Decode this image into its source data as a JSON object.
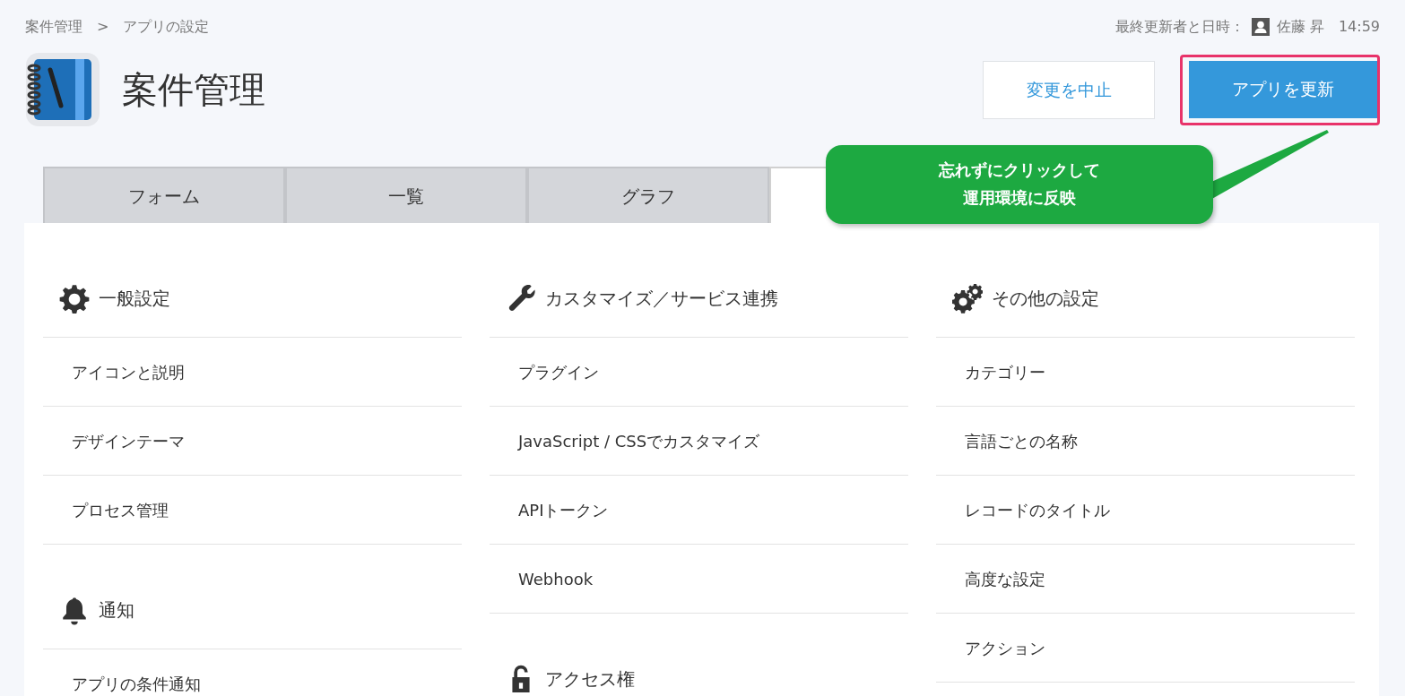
{
  "breadcrumb": {
    "items": [
      {
        "label": "案件管理"
      },
      {
        "label": "アプリの設定"
      }
    ],
    "separator": ">"
  },
  "last_updated": {
    "label": "最終更新者と日時：",
    "user": "佐藤 昇",
    "time": "14:59"
  },
  "app": {
    "title": "案件管理"
  },
  "buttons": [
    {
      "kind": "secondary",
      "label": "変更を中止",
      "highlighted": false
    },
    {
      "kind": "primary",
      "label": "アプリを更新",
      "highlighted": true
    }
  ],
  "callout": {
    "lines": [
      "忘れずにクリックして",
      "運用環境に反映"
    ]
  },
  "tabs": [
    {
      "label": "フォーム",
      "selected": false
    },
    {
      "label": "一覧",
      "selected": false
    },
    {
      "label": "グラフ",
      "selected": false
    },
    {
      "selected": true
    }
  ],
  "columns": [
    {
      "sections": [
        {
          "kind": "gear",
          "title": "一般設定",
          "items": [
            "アイコンと説明",
            "デザインテーマ",
            "プロセス管理"
          ]
        },
        {
          "kind": "bell",
          "title": "通知",
          "items": [
            "アプリの条件通知"
          ]
        }
      ]
    },
    {
      "sections": [
        {
          "kind": "wrench",
          "title": "カスタマイズ／サービス連携",
          "items": [
            "プラグイン",
            "JavaScript / CSSでカスタマイズ",
            "APIトークン",
            "Webhook"
          ]
        },
        {
          "kind": "lock",
          "title": "アクセス権"
        }
      ]
    },
    {
      "sections": [
        {
          "kind": "gears",
          "title": "その他の設定",
          "items": [
            "カテゴリー",
            "言語ごとの名称",
            "レコードのタイトル",
            "高度な設定",
            "アクション"
          ]
        }
      ]
    }
  ]
}
